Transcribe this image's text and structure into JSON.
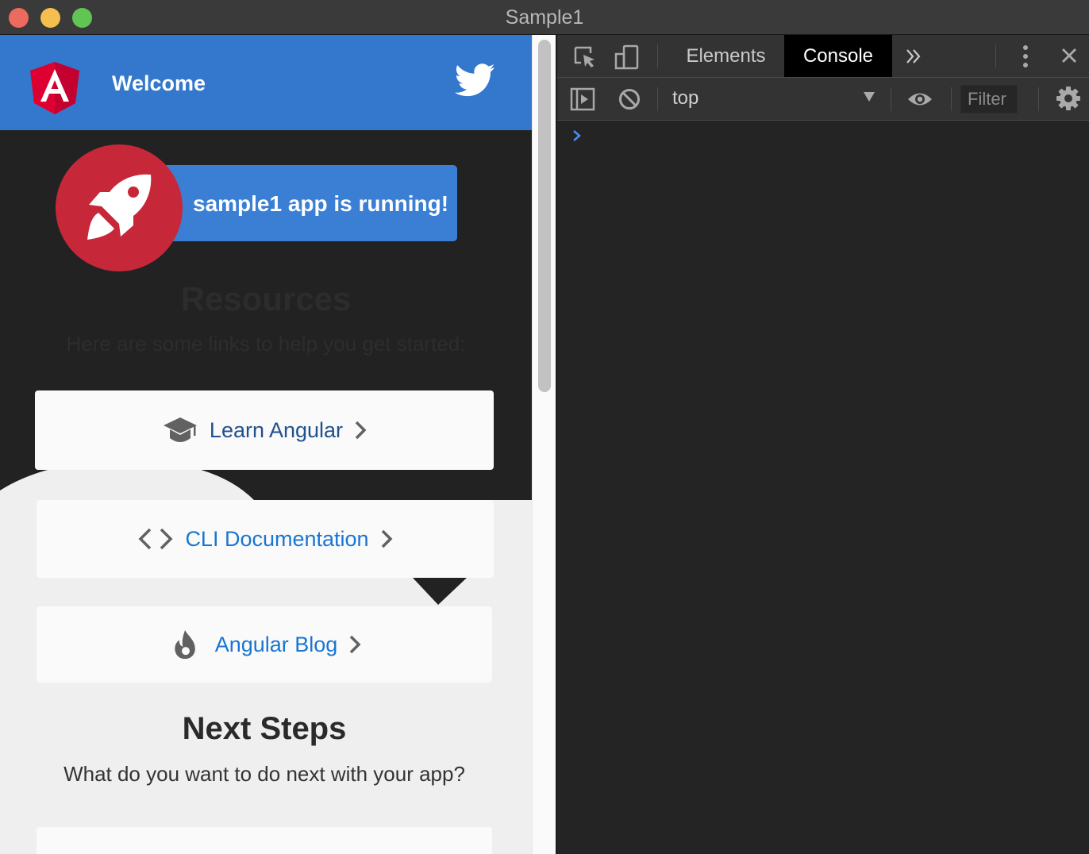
{
  "window": {
    "title": "Sample1"
  },
  "app": {
    "toolbar": {
      "title": "Welcome"
    },
    "running_message": "sample1 app is running!",
    "resources": {
      "title": "Resources",
      "subtitle": "Here are some links to help you get started:"
    },
    "cards": [
      {
        "label": "Learn Angular",
        "icon": "graduation-cap-icon"
      },
      {
        "label": "CLI Documentation",
        "icon": "code-brackets-icon"
      },
      {
        "label": "Angular Blog",
        "icon": "flame-icon"
      }
    ],
    "next_steps": {
      "title": "Next Steps",
      "subtitle": "What do you want to do next with your app?"
    }
  },
  "devtools": {
    "tabs": [
      {
        "label": "Elements",
        "active": false
      },
      {
        "label": "Console",
        "active": true
      }
    ],
    "context": "top",
    "filter_placeholder": "Filter"
  },
  "colors": {
    "toolbar": "#3378cc",
    "angular_red": "#c6283a",
    "link_blue": "#1976d2"
  }
}
